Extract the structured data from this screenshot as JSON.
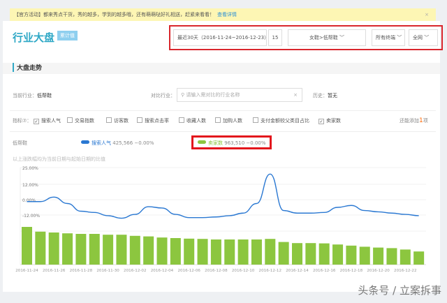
{
  "notice": {
    "text": "【官方活动】都来秀点干货，秀的越多，学到的越多哦，还有萌萌哒好礼相送，赶紧来看看！",
    "link": "查看详情",
    "close": "×"
  },
  "header": {
    "title": "行业大盘",
    "badge": "累计值",
    "date_range": "最近30天（2016-11-24~2016-12-23）",
    "calendar_icon": "15",
    "category": "女鞋>低帮鞋",
    "terminal": "所有终端",
    "channel": "全网"
  },
  "section": {
    "title": "大盘走势"
  },
  "filters": {
    "current_label": "当前行业：",
    "current_value": "低帮鞋",
    "compare_label": "对比行业：",
    "compare_placeholder": "请输入需对比的行业名称",
    "history_label": "历史：",
    "history_value": "暂无"
  },
  "metrics": {
    "label": "指标⑦：",
    "items": [
      {
        "label": "搜索人气",
        "checked": true
      },
      {
        "label": "交易指数",
        "checked": false
      },
      {
        "label": "访客数",
        "checked": false
      },
      {
        "label": "搜索点击率",
        "checked": false
      },
      {
        "label": "收藏人数",
        "checked": false
      },
      {
        "label": "加购人数",
        "checked": false
      },
      {
        "label": "支付金额较父类目占比",
        "checked": false
      },
      {
        "label": "卖家数",
        "checked": true
      }
    ],
    "extra_prefix": "还能添加",
    "extra_count": "1",
    "extra_suffix": "项"
  },
  "legend": {
    "row_label": "低帮鞋",
    "series": [
      {
        "name": "搜索人气",
        "value": "425,566",
        "change": "−0.00%",
        "color": "#2a78d2"
      },
      {
        "name": "卖家数",
        "value": "963,510",
        "change": "−0.00%",
        "color": "#8cc63f"
      }
    ]
  },
  "note": "以上涨跌幅均为当前日期与起始日期的比值",
  "watermark": "头条号 / 立案拆事",
  "chart_data": {
    "type": "bar+line",
    "yticks": [
      "25.00%",
      "12.00%",
      "0.00%",
      "-12.00%"
    ],
    "ytick_values": [
      25,
      12,
      0,
      -12
    ],
    "xlabels": [
      "2016-11-24",
      "2016-11-26",
      "2016-11-28",
      "2016-11-30",
      "2016-12-02",
      "2016-12-04",
      "2016-12-06",
      "2016-12-08",
      "2016-12-10",
      "2016-12-12",
      "2016-12-14",
      "2016-12-16",
      "2016-12-18",
      "2016-12-20",
      "2016-12-22"
    ],
    "line_series": {
      "name": "搜索人气",
      "values": [
        -1.5,
        -1.5,
        2,
        -3,
        -9,
        -10,
        -12.5,
        -14.5,
        -11.5,
        -5.5,
        -6.5,
        -11.5,
        -14,
        -14,
        -13.5,
        -12.5,
        -10.5,
        -3,
        20,
        -8.5,
        -10.5,
        -10.5,
        -10,
        -6,
        -4.5,
        -8.5,
        -9.5,
        -10.5,
        -11.5,
        -12.5
      ]
    },
    "bar_series": {
      "name": "卖家数",
      "values": [
        135,
        118,
        115,
        112,
        110,
        110,
        107,
        107,
        103,
        101,
        97,
        95,
        93,
        92,
        90,
        90,
        90,
        90,
        92,
        81,
        77,
        77,
        76,
        72,
        68,
        64,
        61,
        59,
        54,
        47
      ]
    }
  }
}
